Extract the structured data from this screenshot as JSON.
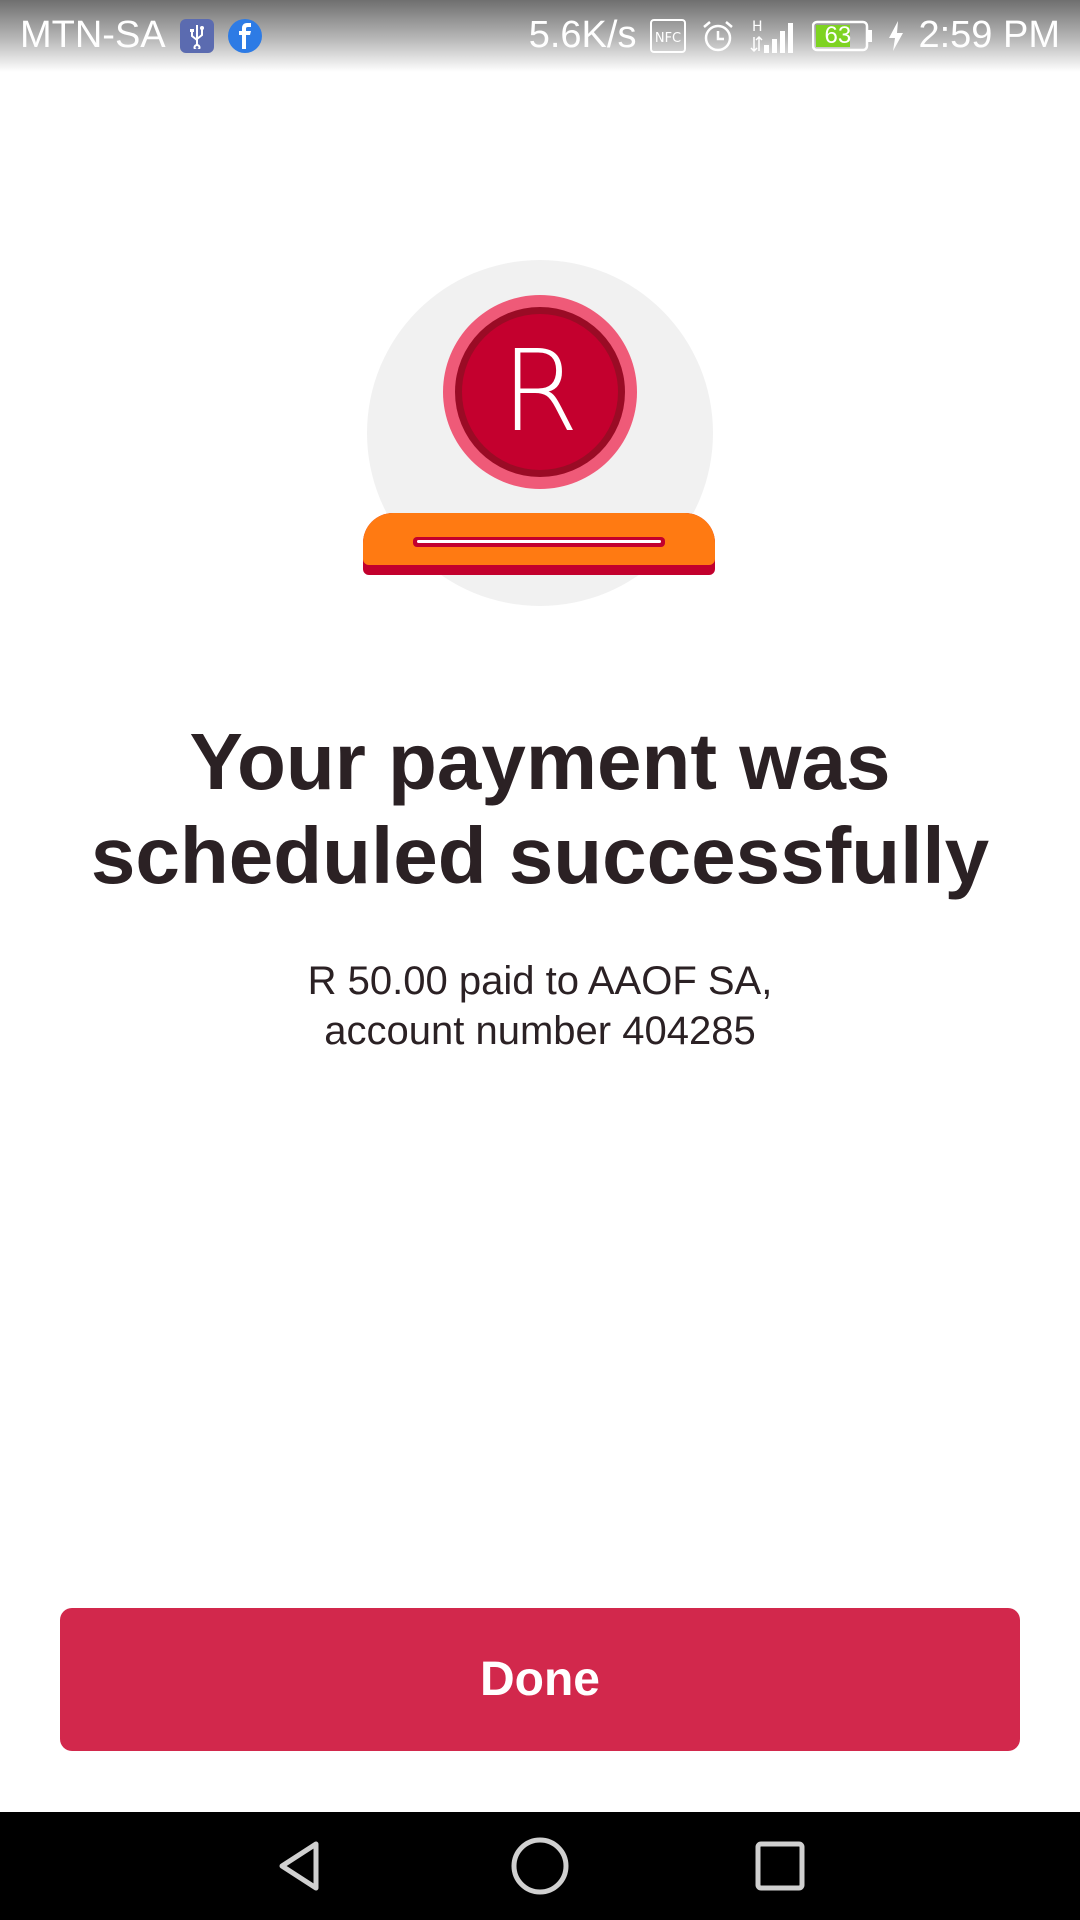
{
  "status_bar": {
    "carrier": "MTN-SA",
    "network_speed": "5.6K/s",
    "nfc_label": "NFC",
    "signal_type": "H",
    "battery_level": "63",
    "time": "2:59 PM",
    "icons": [
      "usb-icon",
      "facebook-icon",
      "nfc-icon",
      "alarm-icon",
      "signal-icon",
      "battery-icon",
      "charging-icon"
    ]
  },
  "illustration": {
    "coin_symbol": "R",
    "colors": {
      "coin_outer": "#ef5a78",
      "coin_inner": "#c4002e",
      "slot_top": "#ff7a12",
      "slot_base": "#c2002d",
      "background_circle": "#f1f1f1"
    }
  },
  "message": {
    "title": "Your payment was scheduled successfully",
    "detail_line1": "R 50.00 paid to AAOF SA,",
    "detail_line2": "account number 404285"
  },
  "actions": {
    "done_label": "Done",
    "done_color": "#d2284c"
  },
  "nav_bar": {
    "icons": [
      "back-icon",
      "home-icon",
      "recents-icon"
    ]
  }
}
